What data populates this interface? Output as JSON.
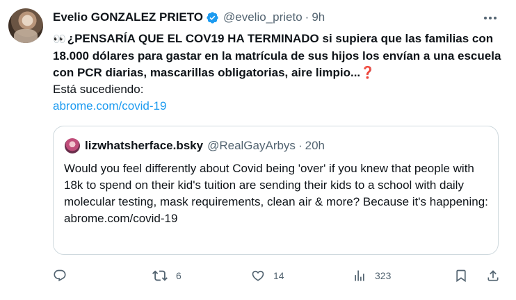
{
  "author": {
    "name": "Evelio GONZALEZ PRIETO",
    "handle": "@evelio_prieto",
    "separator": "·",
    "time": "9h"
  },
  "tweet": {
    "emoji": "👀",
    "bold_text": "¿PENSARÍA QUE EL COV19 HA TERMINADO si supiera que las familias con 18.000 dólares para gastar en la matrícula de sus hijos los envían a una escuela con PCR diarias, mascarillas obligatorias, aire limpio...",
    "question_mark": "❓",
    "line2": "Está sucediendo:",
    "link": "abrome.com/covid-19"
  },
  "quote": {
    "name": "lizwhatsherface.bsky",
    "handle": "@RealGayArbys",
    "separator": "·",
    "time": "20h",
    "text": "Would you feel differently about Covid being 'over' if you knew that people with 18k to spend on their kid's tuition are sending their kids to a school with daily molecular testing, mask requirements, clean air & more? Because it's happening:",
    "link": "abrome.com/covid-19"
  },
  "actions": {
    "reply_count": "",
    "retweet_count": "6",
    "like_count": "14",
    "views_count": "323"
  },
  "icons": {
    "verified": "verified-badge-icon",
    "more": "more-options-icon",
    "reply": "reply-icon",
    "retweet": "retweet-icon",
    "like": "heart-icon",
    "views": "views-icon",
    "bookmark": "bookmark-icon",
    "share": "share-icon"
  },
  "colors": {
    "accent": "#1d9bf0",
    "text": "#0f1419",
    "muted": "#536471",
    "border": "#cfd9de"
  }
}
